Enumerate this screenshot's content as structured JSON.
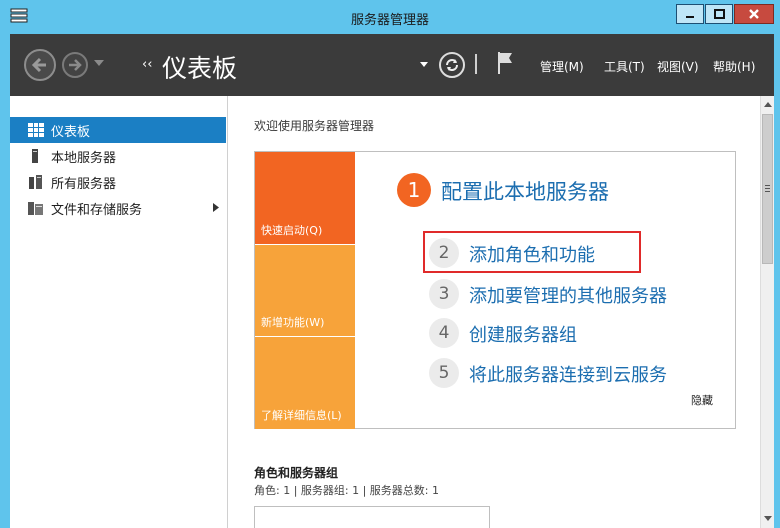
{
  "window": {
    "title": "服务器管理器"
  },
  "toolbar": {
    "breadcrumb_arrow": "‹‹",
    "breadcrumb_title": "仪表板",
    "menus": [
      "管理(M)",
      "工具(T)",
      "视图(V)",
      "帮助(H)"
    ]
  },
  "sidebar": {
    "items": [
      {
        "label": "仪表板",
        "icon": "dashboard-grid-icon",
        "active": true
      },
      {
        "label": "本地服务器",
        "icon": "server-icon",
        "active": false
      },
      {
        "label": "所有服务器",
        "icon": "servers-icon",
        "active": false
      },
      {
        "label": "文件和存储服务",
        "icon": "storage-icon",
        "active": false
      }
    ]
  },
  "main": {
    "welcome_title": "欢迎使用服务器管理器",
    "tiles": [
      "快速启动(Q)",
      "新增功能(W)",
      "了解详细信息(L)"
    ],
    "steps": [
      {
        "num": "1",
        "label": "配置此本地服务器"
      },
      {
        "num": "2",
        "label": "添加角色和功能"
      },
      {
        "num": "3",
        "label": "添加要管理的其他服务器"
      },
      {
        "num": "4",
        "label": "创建服务器组"
      },
      {
        "num": "5",
        "label": "将此服务器连接到云服务"
      }
    ],
    "hide_label": "隐藏",
    "roles_title": "角色和服务器组",
    "roles_summary": "角色: 1 | 服务器组: 1 | 服务器总数: 1"
  },
  "colors": {
    "accent_blue": "#1b7fc4",
    "tile_orange": "#f26522",
    "tile_light_orange": "#f7a33a",
    "link_blue": "#1c6eb0",
    "highlight_red": "#e02a2a",
    "toolbar_bg": "#3b3b3b",
    "frame_blue": "#5fc4ec"
  }
}
